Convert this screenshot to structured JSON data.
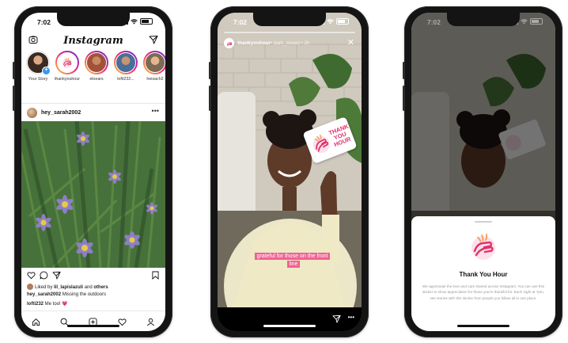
{
  "colors": {
    "accent": "#e2306c",
    "caption_bg": "#f06292",
    "story_gradient": [
      "#f9ce34",
      "#ee2a7b",
      "#6228d7"
    ]
  },
  "phone1": {
    "status_time": "7:02",
    "app_logo": "Instagram",
    "stories": [
      {
        "label": "Your Story",
        "ring": false
      },
      {
        "label": "thankyouhour",
        "ring": true
      },
      {
        "label": "eloears",
        "ring": true
      },
      {
        "label": "lofti232...",
        "ring": true
      },
      {
        "label": "heisach2",
        "ring": true
      }
    ],
    "post": {
      "username": "hey_sarah2002",
      "liked_prefix": "Liked by ",
      "liked_user": "lil_lapislazuli",
      "liked_suffix": " and ",
      "liked_others": "others",
      "caption_user": "hey_sarah2002",
      "caption_text": " Missing the outdoors",
      "comment_user": "lofti232",
      "comment_text": " Me too! 💗"
    },
    "icons": {
      "camera": "camera-icon",
      "send": "paper-plane-icon",
      "like": "heart-icon",
      "comment": "comment-icon",
      "share": "paper-plane-icon",
      "save": "bookmark-icon",
      "more": "more-dots-icon"
    },
    "tabbar": [
      "home-icon",
      "search-icon",
      "add-icon",
      "heart-icon",
      "profile-icon"
    ]
  },
  "phone2": {
    "status_time": "7:02",
    "story_user": "thankyouhour",
    "story_meta": " • dark_sneed • 2h",
    "sticker_text": [
      "THANK",
      "YOU",
      "HOUR"
    ],
    "caption": "grateful for those on the front line"
  },
  "phone3": {
    "status_time": "7:02",
    "sheet_title": "Thank You Hour",
    "sheet_body": "We appreciate the love and care shared across Instagram. You can use this sticker to show appreciation for those you're thankful for. Each night at 7pm, see stories with this sticker from people you follow all in one place."
  }
}
